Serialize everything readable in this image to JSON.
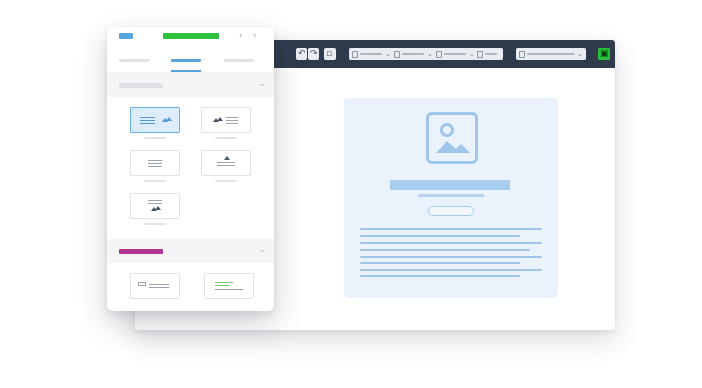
{
  "editor": {
    "toolbar": {
      "undo_icon": "undo-icon",
      "redo_icon": "redo-icon",
      "page_icon": "page-icon",
      "undo_glyph": "↶",
      "redo_glyph": "↷",
      "page_glyph": "▫",
      "chevron_glyph": "⌄",
      "device_glyph": "▣",
      "colors": {
        "bar": "#2f3b4c",
        "preview": "#28c23a"
      }
    },
    "canvas": {
      "block_background": "#eaf3fc",
      "accent": "#9fc6ea",
      "image_icon": "image-placeholder-icon"
    }
  },
  "panel": {
    "header": {
      "back_glyph": "‹",
      "forward_glyph": "›",
      "colors": {
        "logo": "#5aa4de",
        "title": "#2ec240"
      }
    },
    "active_tab_index": 1,
    "sections": [
      {
        "label_color": "#dfe3e8",
        "chevron": "⌄"
      },
      {
        "label_color": "#b3348f",
        "chevron": "⌄"
      }
    ]
  }
}
